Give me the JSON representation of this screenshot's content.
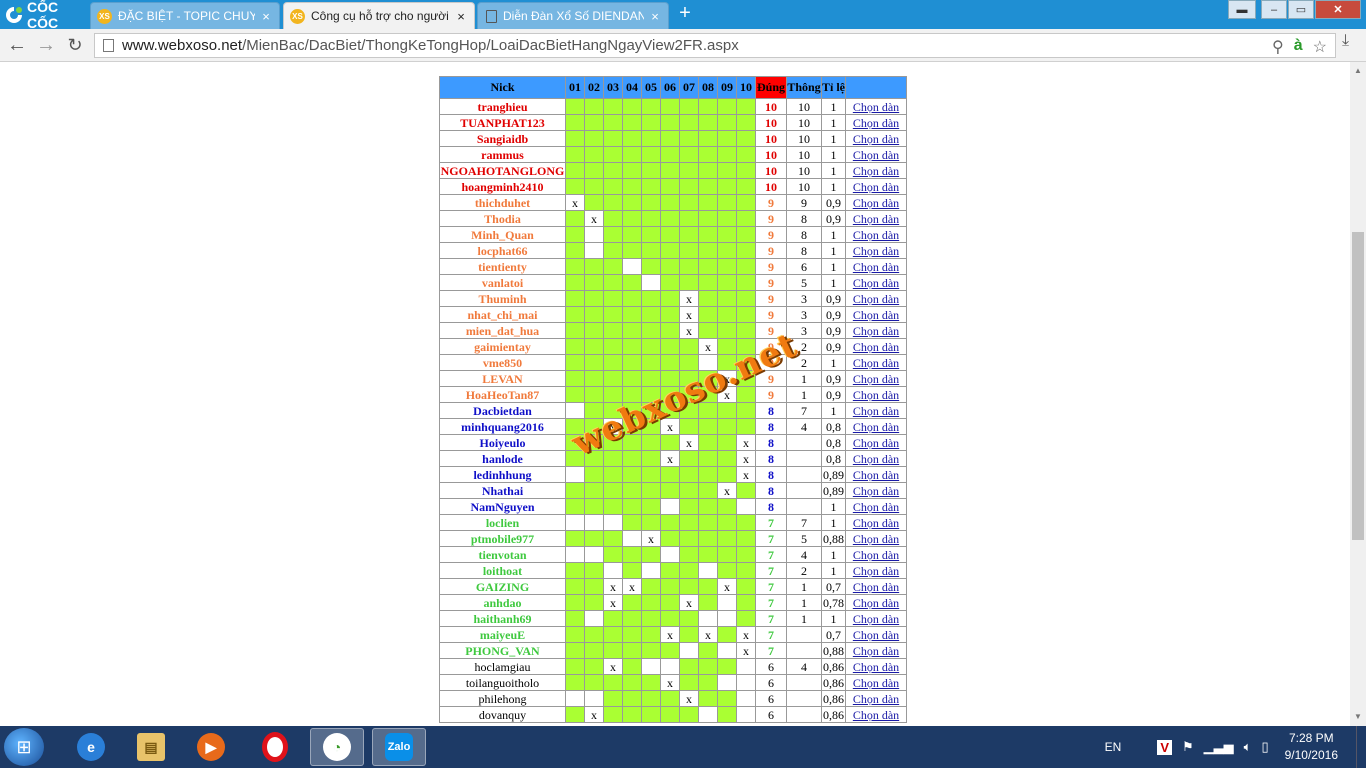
{
  "browser": {
    "brand": "CỐC CỐC",
    "tabs": [
      {
        "title": "ĐẶC BIỆT - TOPIC CHUYÊN",
        "favicon": "XS",
        "active": false
      },
      {
        "title": "Công cụ hỗ trợ cho người",
        "favicon": "XS",
        "active": true
      },
      {
        "title": "Diễn Đàn Xổ Số DIENDAN",
        "favicon": "",
        "active": false
      }
    ],
    "url_domain": "www.webxoso.net",
    "url_path": "/MienBac/DacBiet/ThongKeTongHop/LoaiDacBietHangNgayView2FR.aspx"
  },
  "table": {
    "headers": {
      "nick": "Nick",
      "cols": [
        "01",
        "02",
        "03",
        "04",
        "05",
        "06",
        "07",
        "08",
        "09",
        "10"
      ],
      "dung": "Đúng",
      "thong": "Thông",
      "tile": "Tỉ lệ"
    },
    "link_label": "Chọn dàn",
    "rows": [
      {
        "nick": "tranghieu",
        "tier": "red",
        "marks": {},
        "dung": "10",
        "thong": "10",
        "tile": "1"
      },
      {
        "nick": "TUANPHAT123",
        "tier": "red",
        "marks": {},
        "dung": "10",
        "thong": "10",
        "tile": "1"
      },
      {
        "nick": "Sangiaidb",
        "tier": "red",
        "marks": {},
        "dung": "10",
        "thong": "10",
        "tile": "1"
      },
      {
        "nick": "rammus",
        "tier": "red",
        "marks": {},
        "dung": "10",
        "thong": "10",
        "tile": "1"
      },
      {
        "nick": "NGOAHOTANGLONG",
        "tier": "red",
        "marks": {},
        "dung": "10",
        "thong": "10",
        "tile": "1"
      },
      {
        "nick": "hoangminh2410",
        "tier": "red",
        "marks": {},
        "dung": "10",
        "thong": "10",
        "tile": "1"
      },
      {
        "nick": "thichduhet",
        "tier": "orange",
        "marks": {
          "0": "x"
        },
        "dung": "9",
        "thong": "9",
        "tile": "0,9"
      },
      {
        "nick": "Thodia",
        "tier": "orange",
        "marks": {
          "1": "x"
        },
        "dung": "9",
        "thong": "8",
        "tile": "0,9"
      },
      {
        "nick": "Minh_Quan",
        "tier": "orange",
        "marks": {
          "1": ""
        },
        "dung": "9",
        "thong": "8",
        "tile": "1"
      },
      {
        "nick": "locphat66",
        "tier": "orange",
        "marks": {
          "1": ""
        },
        "dung": "9",
        "thong": "8",
        "tile": "1"
      },
      {
        "nick": "tientienty",
        "tier": "orange",
        "marks": {
          "3": ""
        },
        "dung": "9",
        "thong": "6",
        "tile": "1"
      },
      {
        "nick": "vanlatoi",
        "tier": "orange",
        "marks": {
          "4": ""
        },
        "dung": "9",
        "thong": "5",
        "tile": "1"
      },
      {
        "nick": "Thuminh",
        "tier": "orange",
        "marks": {
          "6": "x"
        },
        "dung": "9",
        "thong": "3",
        "tile": "0,9"
      },
      {
        "nick": "nhat_chi_mai",
        "tier": "orange",
        "marks": {
          "6": "x"
        },
        "dung": "9",
        "thong": "3",
        "tile": "0,9"
      },
      {
        "nick": "mien_dat_hua",
        "tier": "orange",
        "marks": {
          "6": "x"
        },
        "dung": "9",
        "thong": "3",
        "tile": "0,9"
      },
      {
        "nick": "gaimientay",
        "tier": "orange",
        "marks": {
          "7": "x"
        },
        "dung": "9",
        "thong": "2",
        "tile": "0,9"
      },
      {
        "nick": "vme850",
        "tier": "orange",
        "marks": {
          "7": ""
        },
        "dung": "9",
        "thong": "2",
        "tile": "1"
      },
      {
        "nick": "LEVAN",
        "tier": "orange",
        "marks": {
          "8": "x"
        },
        "dung": "9",
        "thong": "1",
        "tile": "0,9"
      },
      {
        "nick": "HoaHeoTan87",
        "tier": "orange",
        "marks": {
          "8": "x"
        },
        "dung": "9",
        "thong": "1",
        "tile": "0,9"
      },
      {
        "nick": "Dacbietdan",
        "tier": "blue",
        "marks": {
          "0": ""
        },
        "dung": "8",
        "thong": "7",
        "tile": "1"
      },
      {
        "nick": "minhquang2016",
        "tier": "blue",
        "marks": {
          "2": "x",
          "5": "x"
        },
        "dung": "8",
        "thong": "4",
        "tile": "0,8"
      },
      {
        "nick": "Hoiyeulo",
        "tier": "blue",
        "marks": {
          "6": "x",
          "9": "x"
        },
        "dung": "8",
        "thong": "",
        "tile": "0,8"
      },
      {
        "nick": "hanlode",
        "tier": "blue",
        "marks": {
          "5": "x",
          "9": "x"
        },
        "dung": "8",
        "thong": "",
        "tile": "0,8"
      },
      {
        "nick": "ledinhhung",
        "tier": "blue",
        "marks": {
          "0": "",
          "9": "x"
        },
        "dung": "8",
        "thong": "",
        "tile": "0,89"
      },
      {
        "nick": "Nhathai",
        "tier": "blue",
        "marks": {
          "8": "x"
        },
        "dung": "8",
        "thong": "",
        "tile": "0,89"
      },
      {
        "nick": "NamNguyen",
        "tier": "blue",
        "marks": {
          "5": "",
          "9": ""
        },
        "dung": "8",
        "thong": "",
        "tile": "1"
      },
      {
        "nick": "loclien",
        "tier": "green",
        "marks": {
          "0": "",
          "1": "",
          "2": ""
        },
        "dung": "7",
        "thong": "7",
        "tile": "1"
      },
      {
        "nick": "ptmobile977",
        "tier": "green",
        "marks": {
          "3": "",
          "4": "x"
        },
        "dung": "7",
        "thong": "5",
        "tile": "0,88"
      },
      {
        "nick": "tienvotan",
        "tier": "green",
        "marks": {
          "0": "",
          "1": "",
          "5": ""
        },
        "dung": "7",
        "thong": "4",
        "tile": "1"
      },
      {
        "nick": "loithoat",
        "tier": "green",
        "marks": {
          "2": "",
          "4": "",
          "7": ""
        },
        "dung": "7",
        "thong": "2",
        "tile": "1"
      },
      {
        "nick": "GAIZING",
        "tier": "green",
        "marks": {
          "2": "x",
          "3": "x",
          "8": "x"
        },
        "dung": "7",
        "thong": "1",
        "tile": "0,7"
      },
      {
        "nick": "anhdao",
        "tier": "green",
        "marks": {
          "2": "x",
          "6": "x",
          "8": ""
        },
        "dung": "7",
        "thong": "1",
        "tile": "0,78"
      },
      {
        "nick": "haithanh69",
        "tier": "green",
        "marks": {
          "1": "",
          "7": "",
          "8": ""
        },
        "dung": "7",
        "thong": "1",
        "tile": "1"
      },
      {
        "nick": "maiyeuE",
        "tier": "green",
        "marks": {
          "5": "x",
          "7": "x",
          "9": "x"
        },
        "dung": "7",
        "thong": "",
        "tile": "0,7"
      },
      {
        "nick": "PHONG_VAN",
        "tier": "green",
        "marks": {
          "6": "",
          "8": "",
          "9": "x"
        },
        "dung": "7",
        "thong": "",
        "tile": "0,88"
      },
      {
        "nick": "hoclamgiau",
        "tier": "black",
        "marks": {
          "2": "x",
          "4": "",
          "5": "",
          "9": ""
        },
        "dung": "6",
        "thong": "4",
        "tile": "0,86"
      },
      {
        "nick": "toilanguoitholo",
        "tier": "black",
        "marks": {
          "5": "x",
          "8": "",
          "9": ""
        },
        "dung": "6",
        "thong": "",
        "tile": "0,86"
      },
      {
        "nick": "philehong",
        "tier": "black",
        "marks": {
          "0": "",
          "1": "",
          "6": "x",
          "9": ""
        },
        "dung": "6",
        "thong": "",
        "tile": "0,86"
      },
      {
        "nick": "dovanquy",
        "tier": "black",
        "marks": {
          "1": "x",
          "7": "",
          "9": ""
        },
        "dung": "6",
        "thong": "",
        "tile": "0,86"
      }
    ]
  },
  "watermark": "webxoso.net",
  "colors": {
    "green": "#aaff33",
    "header": "#3d9aff",
    "hot": "#ff0000",
    "red": "#e00000",
    "orange": "#f07a3c",
    "blue": "#1010c8",
    "lightgreen": "#3fc93f"
  },
  "taskbar": {
    "apps": [
      "ie-icon",
      "explorer-icon",
      "media-player-icon",
      "opera-icon",
      "coccoc-icon",
      "zalo-icon"
    ],
    "zalo_label": "Zalo",
    "lang": "EN",
    "time": "7:28 PM",
    "date": "9/10/2016"
  }
}
